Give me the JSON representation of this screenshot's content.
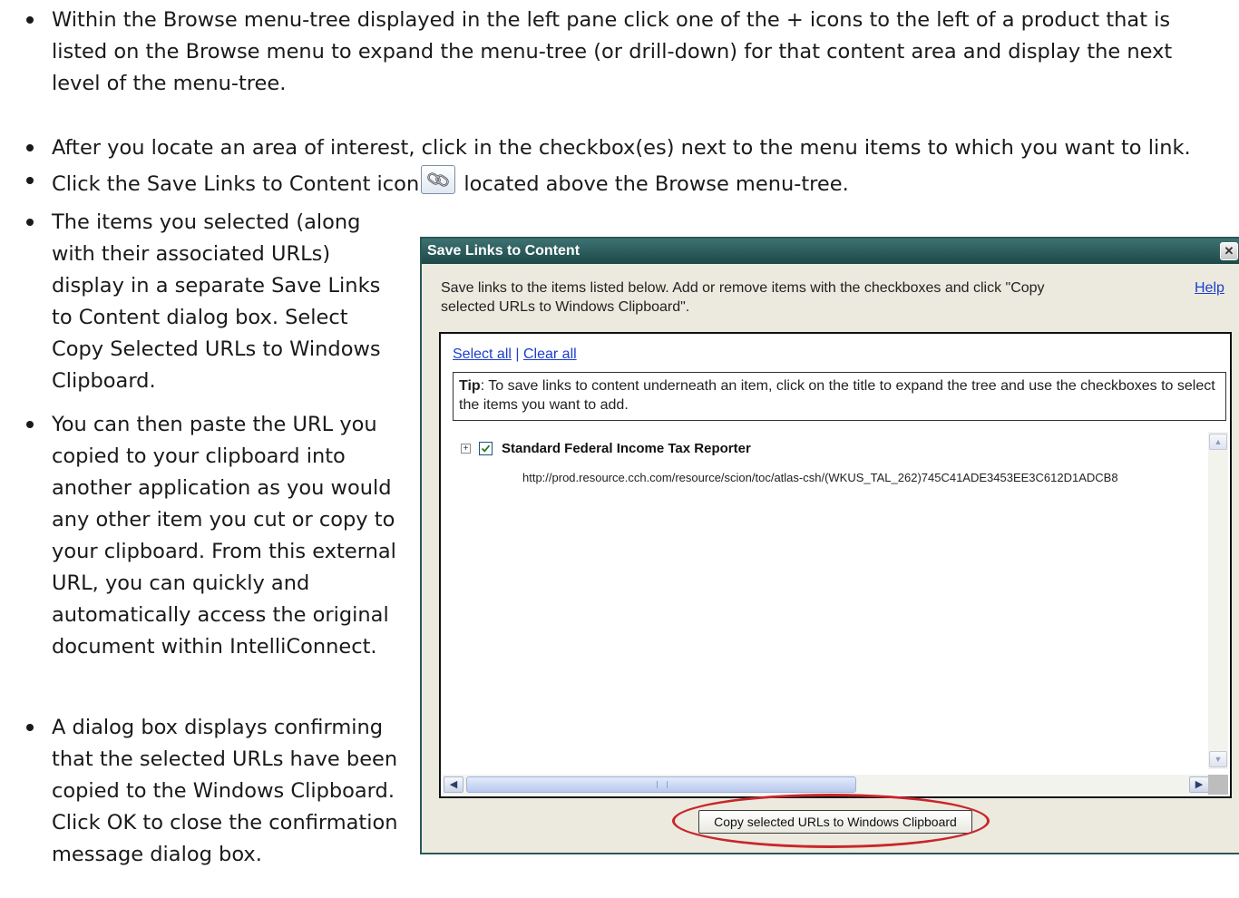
{
  "instructions": {
    "items": [
      {
        "text": "Within the Browse menu-tree displayed in the left pane click one of the + icons to the left of a product that is listed on the Browse menu to expand the menu-tree (or drill-down) for that content area and display the next level of the menu-tree."
      },
      {
        "text": "After you locate an area of interest, click in the checkbox(es) next to the menu items to which you want to link."
      },
      {
        "before_icon": "Click the Save Links to Content icon",
        "after_icon": "located above the Browse menu-tree.",
        "icon": "chain-link-icon"
      },
      {
        "text": "The items you selected (along with their associated URLs) display in a separate Save Links to Content dialog box. Select Copy Selected URLs to Windows Clipboard."
      },
      {
        "text": "You can then paste the URL you copied to your clipboard into another application as you would any other item you cut or copy to your clipboard. From this external URL, you can quickly and automatically access the original document within IntelliConnect."
      },
      {
        "text": "A dialog box displays confirming that the selected URLs have been copied to the Windows Clipboard. Click OK to close the confirmation message dialog box."
      }
    ]
  },
  "dialog": {
    "title": "Save Links to Content",
    "close_glyph": "✕",
    "intro": "Save links to the items listed below. Add or remove items with the checkboxes and click \"Copy selected URLs to Windows Clipboard\".",
    "help_label": "Help",
    "select_all_label": "Select all",
    "separator": "|",
    "clear_all_label": "Clear all",
    "tip_label": "Tip",
    "tip_text": ": To save links to content underneath an item, click on the title to expand the tree and use the checkboxes to select the items you want to add.",
    "tree": [
      {
        "expander": "+",
        "checked": true,
        "title": "Standard Federal Income Tax Reporter",
        "url": "http://prod.resource.cch.com/resource/scion/toc/atlas-csh/(WKUS_TAL_262)745C41ADE3453EE3C612D1ADCB8"
      }
    ],
    "copy_button_label": "Copy selected URLs to Windows Clipboard",
    "highlight_color": "#c8262b",
    "title_bar_color": "#2b5858"
  }
}
